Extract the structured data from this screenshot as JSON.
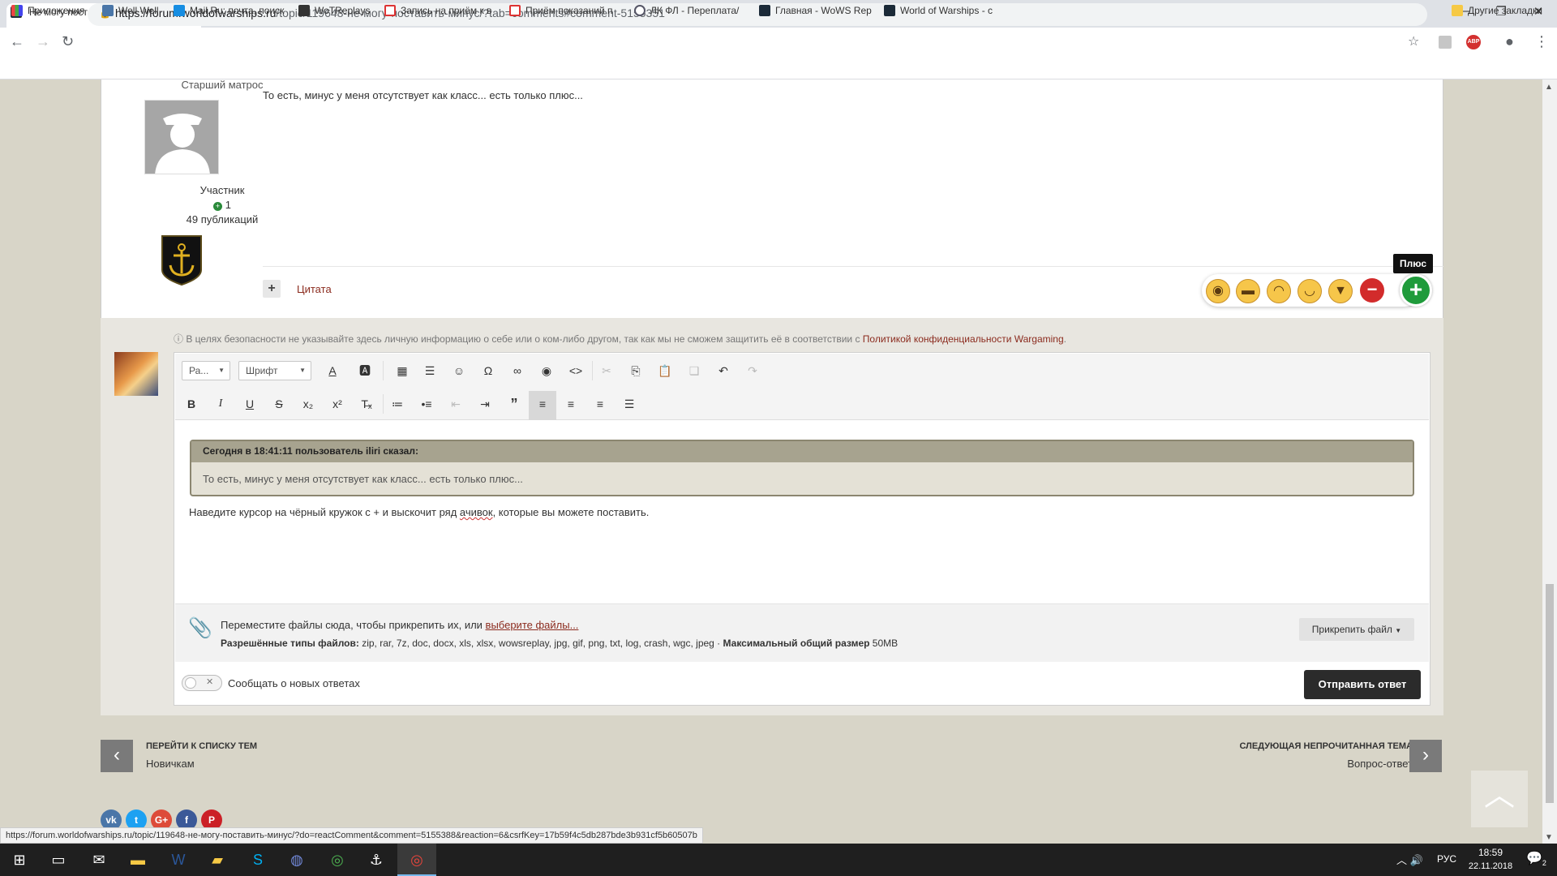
{
  "browser": {
    "tab_title": "Не могу поставить минус! - Новичкам",
    "url_host": "https://forum.worldofwarships.ru",
    "url_rest": "/topic/119648-не-могу-поставить-минус/?tab=comments#comment-5155351",
    "bookmarks": [
      "Приложения",
      "Well Well",
      "Mail.Ru: почта, поиск",
      "WoTReplays",
      "Запись на приём к в",
      "Приём показаний п",
      "ЛК ФЛ - Переплата/",
      "Главная - WoWS Rep",
      "World of Warships - с",
      "Другие закладки"
    ],
    "status_url": "https://forum.worldofwarships.ru/topic/119648-не-могу-поставить-минус/?do=reactComment&comment=5155388&reaction=6&csrfKey=17b59f4c5db287bde3b931cf5b60507b"
  },
  "post": {
    "rank": "Старший матрос",
    "role": "Участник",
    "reputation": "1",
    "publications": "49 публикаций",
    "text": "То есть, минус у меня отсутствует как класс... есть только плюс...",
    "quote_label": "Цитата",
    "tooltip": "Плюс"
  },
  "reply": {
    "privacy_text": "В целях безопасности не указывайте здесь личную информацию о себе или о ком-либо другом, так как мы не сможем защитить её в соответствии с",
    "privacy_link": "Политикой конфиденциальности Wargaming",
    "format_dropdown": "Ра...",
    "font_dropdown": "Шрифт",
    "quote_citation": "Сегодня в 18:41:11 пользователь iliri сказал:",
    "quote_body": "То есть, минус у меня отсутствует как класс... есть только плюс...",
    "text_before": "Наведите курсор на чёрный кружок с + и выскочит ряд ",
    "text_misspelled": "ачивок",
    "text_after": ", которые вы можете поставить.",
    "attach_hint": "Переместите файлы сюда, чтобы прикрепить их, или ",
    "attach_link": "выберите файлы...",
    "allowed_label": "Разрешённые типы файлов:",
    "allowed_types": " zip, rar, 7z, doc, docx, xls, xlsx, wowsreplay, jpg, gif, png, txt, log, crash, wgc, jpeg · ",
    "max_label": "Максимальный общий размер",
    "max_value": " 50MB",
    "attach_button": "Прикрепить файл",
    "notify_label": "Сообщать о новых ответах",
    "submit": "Отправить ответ"
  },
  "pagination": {
    "prev_title": "ПЕРЕЙТИ К СПИСКУ ТЕМ",
    "prev_sub": "Новичкам",
    "next_title": "СЛЕДУЮЩАЯ НЕПРОЧИТАННАЯ ТЕМА",
    "next_sub": "Вопрос-ответ"
  },
  "taskbar": {
    "lang": "РУС",
    "time": "18:59",
    "date": "22.11.2018",
    "notifications": "2"
  },
  "colors": {
    "accent_link": "#8b2b1e",
    "plus_green": "#1f9b3b",
    "minus_red": "#d22b2b",
    "page_bg": "#d8d5c8"
  }
}
